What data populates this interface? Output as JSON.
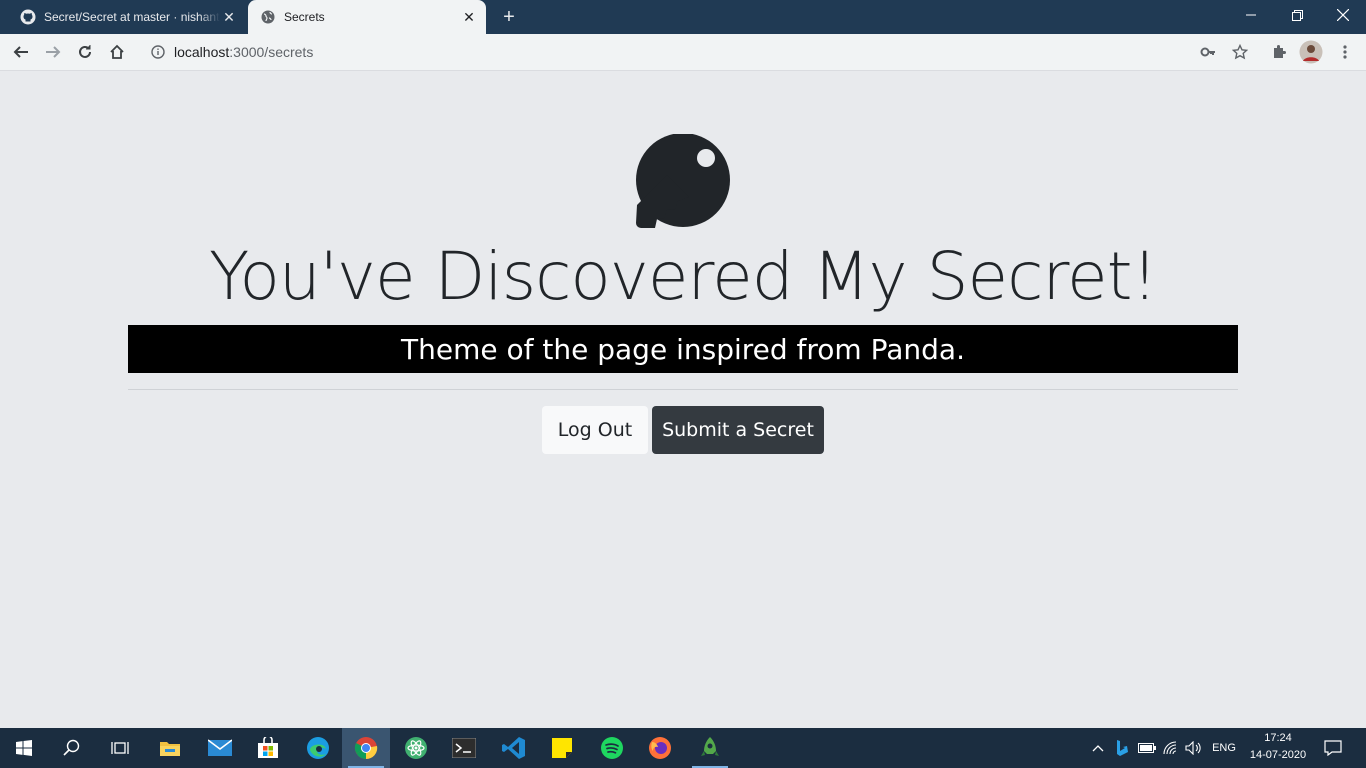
{
  "browser": {
    "tabs": [
      {
        "title": "Secret/Secret at master · nishanth",
        "active": false
      },
      {
        "title": "Secrets",
        "active": true
      }
    ],
    "new_tab_label": "+",
    "url_host": "localhost",
    "url_path": ":3000/secrets"
  },
  "page": {
    "heading": "You've Discovered My Secret!",
    "banner_text": "Theme of the page inspired from Panda.",
    "logout_label": "Log Out",
    "submit_label": "Submit a Secret"
  },
  "taskbar": {
    "apps": [
      "start",
      "search",
      "task-view",
      "file-explorer",
      "mail",
      "store",
      "edge",
      "chrome",
      "atom",
      "terminal",
      "vscode",
      "sticky-notes",
      "spotify",
      "firefox",
      "robo3t"
    ],
    "language": "ENG",
    "time": "17:24",
    "date": "14-07-2020"
  },
  "colors": {
    "tabstrip": "#203a54",
    "page_bg": "#e8eaed",
    "banner_bg": "#000000",
    "dark_button": "#343a40",
    "light_button": "#f8f9fa",
    "taskbar": "#1b2d40"
  }
}
